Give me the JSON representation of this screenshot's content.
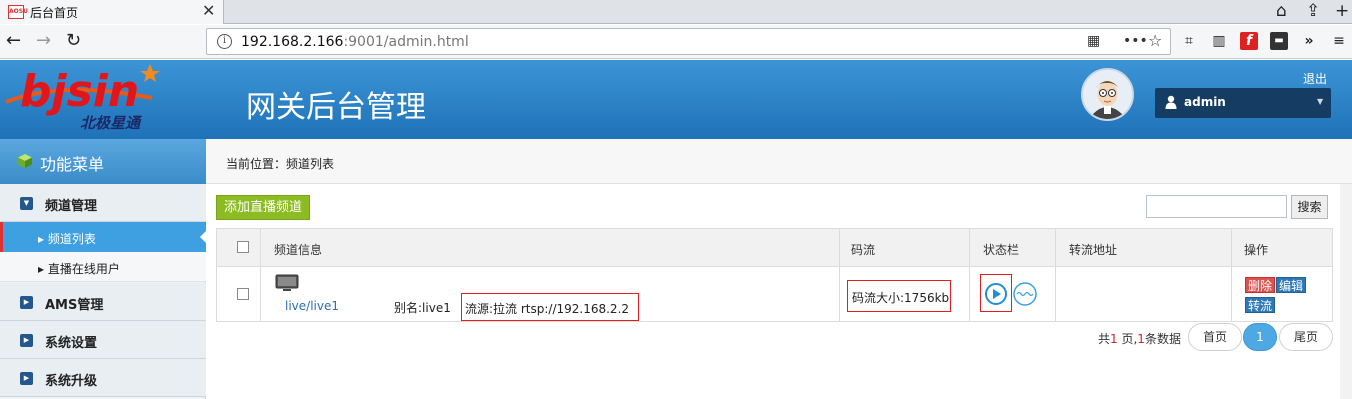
{
  "browser": {
    "tab_title": "后台首页",
    "favicon_text": "AOSU",
    "url_host": "192.168.2.166",
    "url_rest": ":9001/admin.html"
  },
  "header": {
    "logo_text": "bjsin",
    "logo_sub": "北极星通",
    "title": "网关后台管理",
    "logout": "退出",
    "username": "admin"
  },
  "sidebar": {
    "title": "功能菜单",
    "groups": [
      {
        "label": "频道管理"
      },
      {
        "label": "AMS管理"
      },
      {
        "label": "系统设置"
      },
      {
        "label": "系统升级"
      }
    ],
    "subitems": [
      {
        "label": "频道列表"
      },
      {
        "label": "直播在线用户"
      }
    ]
  },
  "main": {
    "breadcrumb": "当前位置：频道列表",
    "add_button": "添加直播频道",
    "search_button": "搜索",
    "search_value": "",
    "columns": [
      "频道信息",
      "码流",
      "状态栏",
      "转流地址",
      "操作"
    ],
    "rows": [
      {
        "name": "live/live1",
        "alias": "别名:live1",
        "source": "流源:拉流  rtsp://192.168.2.2",
        "bitrate": "码流大小:1756kb",
        "relay": "",
        "actions": [
          "删除",
          "编辑",
          "转流"
        ]
      }
    ],
    "pager": {
      "prefix": "共",
      "pages": "1",
      "mid": " 页,",
      "records": "1",
      "suffix": "条数据",
      "first": "首页",
      "current": "1",
      "last": "尾页"
    }
  },
  "colors": {
    "header_blue": "#2a82c6",
    "active_blue": "#3ea0e0",
    "add_green": "#8cbc21",
    "highlight_red": "#e02020",
    "delete_red": "#d9534f"
  },
  "icons": [
    "back-arrow-icon",
    "forward-arrow-icon",
    "reload-icon",
    "info-icon",
    "qr-icon",
    "more-icon",
    "bookmark-star-icon",
    "crop-icon",
    "reader-icon",
    "flash-icon",
    "extension-icon",
    "overflow-icon",
    "menu-icon",
    "home-icon",
    "upload-icon",
    "plus-icon",
    "user-icon",
    "cube-icon",
    "tv-icon",
    "play-icon",
    "wave-icon"
  ]
}
